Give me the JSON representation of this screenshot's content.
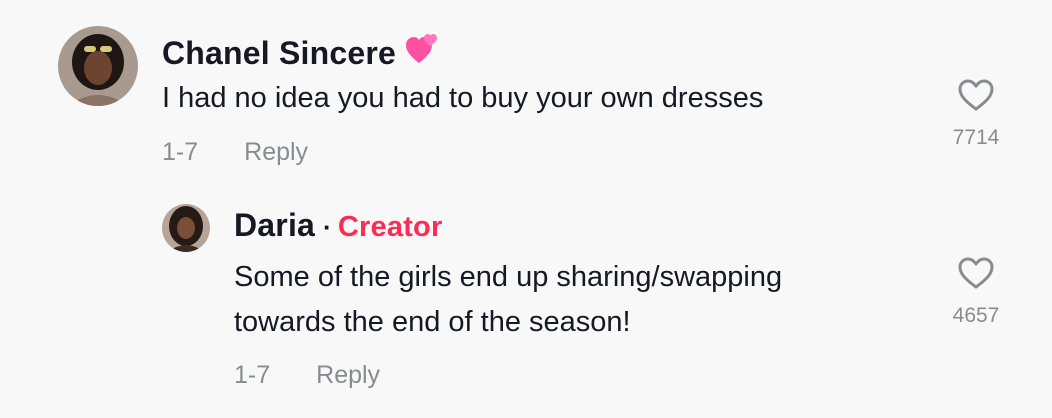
{
  "comment": {
    "author": "Chanel Sincere",
    "author_emoji_icon": "two-hearts-icon",
    "text": "I had no idea you had to buy your own dresses",
    "date": "1-7",
    "reply_label": "Reply",
    "like_count": "7714"
  },
  "reply": {
    "author": "Daria",
    "separator": "·",
    "badge": "Creator",
    "text_lines": [
      "Some of the girls end up sharing/swapping",
      "towards the end of the season!"
    ],
    "date": "1-7",
    "reply_label": "Reply",
    "like_count": "4657"
  },
  "colors": {
    "background": "#f8f8f8",
    "text_primary": "#161823",
    "text_secondary": "#8a8b91",
    "creator_accent": "#fe2c55",
    "emoji_pink": "#ff4fa3"
  }
}
